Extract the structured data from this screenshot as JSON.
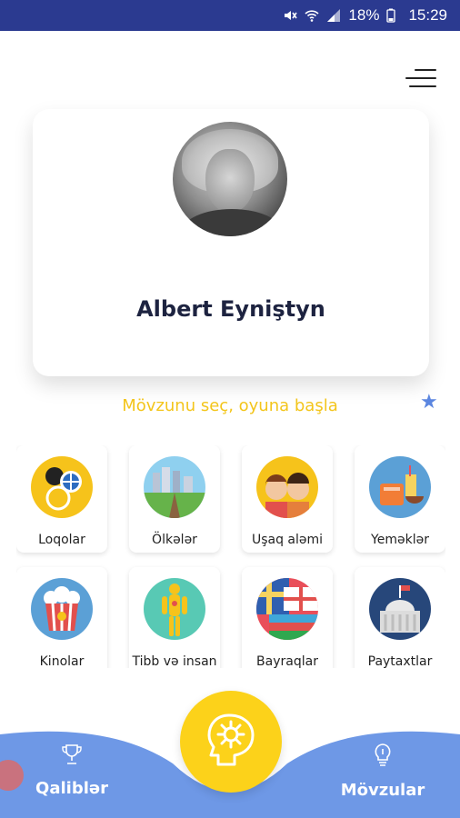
{
  "status_bar": {
    "battery": "18%",
    "time": "15:29",
    "icons": [
      "mute-icon",
      "wifi-icon",
      "signal-icon",
      "battery-icon"
    ]
  },
  "header": {
    "menu_icon": "menu-icon"
  },
  "profile": {
    "name": "Albert Eyniştyn"
  },
  "prompt": "Mövzunu seç, oyuna başla",
  "categories": [
    {
      "label": "Loqolar",
      "icon": "logos-icon",
      "bg": "#f6c31b"
    },
    {
      "label": "Ölkələr",
      "icon": "countries-icon",
      "bg": "#8fd0ef"
    },
    {
      "label": "Uşaq aləmi",
      "icon": "kids-icon",
      "bg": "#f6c31b"
    },
    {
      "label": "Yeməklər",
      "icon": "food-icon",
      "bg": "#5ba0d6"
    },
    {
      "label": "Kinolar",
      "icon": "movies-icon",
      "bg": "#5ba0d6"
    },
    {
      "label": "Tibb və insan",
      "icon": "medicine-icon",
      "bg": "#58c9b4"
    },
    {
      "label": "Bayraqlar",
      "icon": "flags-icon",
      "bg": "#e94f5a"
    },
    {
      "label": "Paytaxtlar",
      "icon": "capitals-icon",
      "bg": "#27477a"
    }
  ],
  "bottom_nav": {
    "left": {
      "label": "Qaliblər",
      "icon": "trophy-icon"
    },
    "right": {
      "label": "Mövzular",
      "icon": "lightbulb-icon"
    },
    "center": {
      "icon": "brain-gear-icon"
    }
  },
  "colors": {
    "accent": "#fcd21a",
    "nav_bg": "#6e98e6",
    "statusbar": "#2b3a90",
    "prompt": "#f3c51b"
  }
}
